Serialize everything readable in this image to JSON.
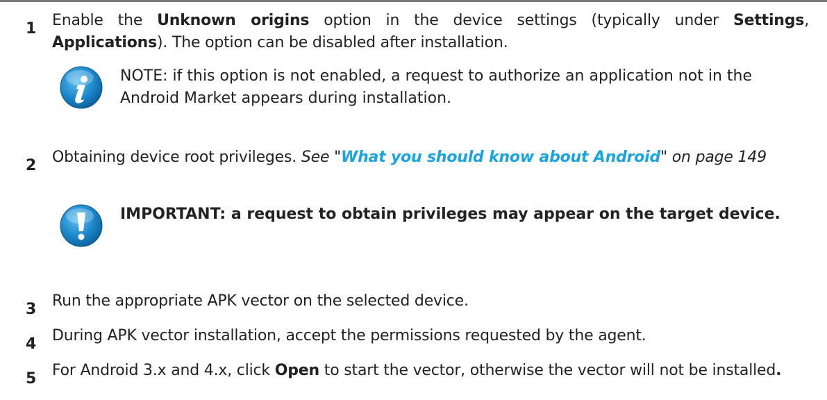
{
  "steps": [
    {
      "number": "1",
      "text_a": "Enable the ",
      "bold_a": "Unknown origins",
      "text_b": " option in the device settings (typically under ",
      "bold_b": "Settings",
      "text_c": ", ",
      "bold_c": "Applications",
      "text_d": "). The option can be disabled after installation."
    },
    {
      "number": "2",
      "text_a": "Obtaining device root privileges. ",
      "italic_see": "See \"",
      "link_text": "What you should know about Android",
      "italic_tail": "\" on page 149"
    },
    {
      "number": "3",
      "text": "Run the appropriate APK vector on the selected device."
    },
    {
      "number": "4",
      "text": "During APK vector installation, accept the permissions requested by the agent."
    },
    {
      "number": "5",
      "text_a": "For Android 3.x and 4.x, click ",
      "bold_a": "Open",
      "text_b": " to start the vector, otherwise the vector will not be installed",
      "bold_end": "."
    }
  ],
  "notes": {
    "info": {
      "icon": "info-icon",
      "text": "NOTE: if this option is not enabled, a request to authorize an application not in the Android Market appears during installation."
    },
    "important": {
      "icon": "exclamation-icon",
      "text": "IMPORTANT: a request to obtain privileges may appear on the target device."
    }
  },
  "colors": {
    "link": "#1aa3e0",
    "icon_blue": "#1a86c9",
    "rule": "#7a7a7a"
  }
}
